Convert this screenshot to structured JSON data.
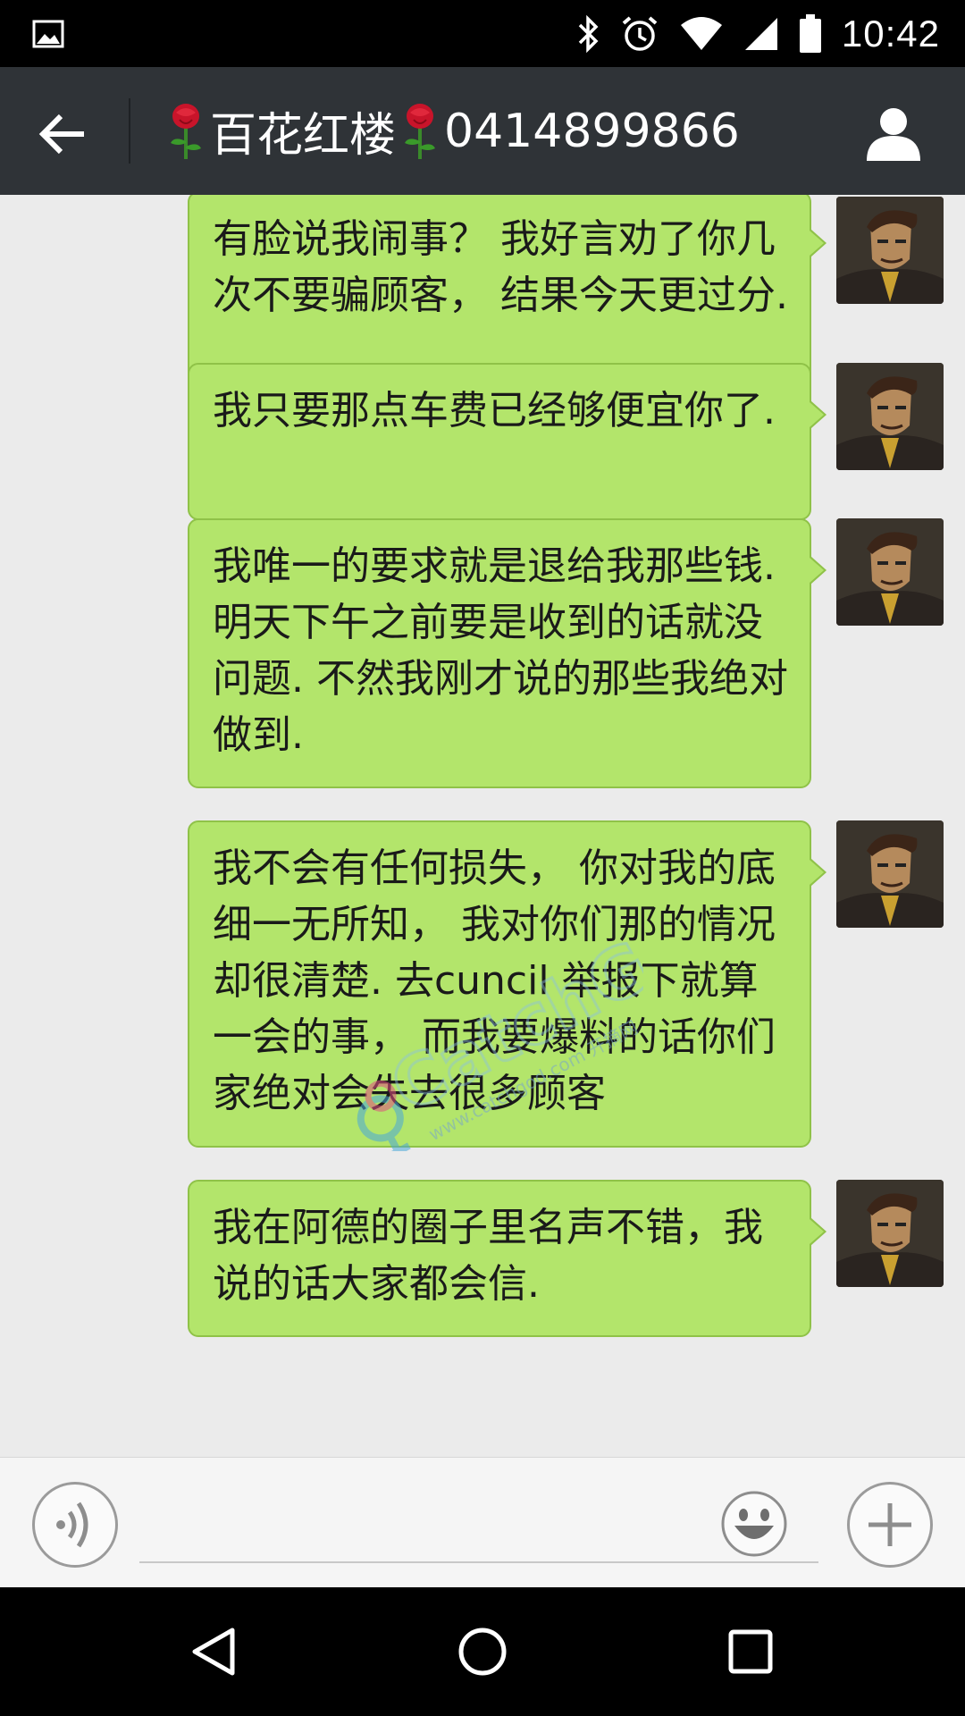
{
  "status_bar": {
    "time": "10:42",
    "icons": [
      "gallery-icon",
      "bluetooth-icon",
      "alarm-icon",
      "wifi-icon",
      "signal-icon",
      "battery-icon"
    ]
  },
  "app_bar": {
    "title": "百花红楼",
    "phone": "0414899866",
    "back_icon": "arrow-left-icon",
    "profile_icon": "person-icon",
    "title_decoration_icon": "rose-icon"
  },
  "messages": [
    {
      "sender": "me",
      "text": "有脸说我闹事？ 我好言劝了你几次不要骗顾客， 结果今天更过分."
    },
    {
      "sender": "me",
      "text": "我只要那点车费已经够便宜你了."
    },
    {
      "sender": "me",
      "text": "我唯一的要求就是退给我那些钱. 明天下午之前要是收到的话就没问题. 不然我刚才说的那些我绝对做到."
    },
    {
      "sender": "me",
      "text": "我不会有任何损失， 你对我的底细一无所知， 我对你们那的情况却很清楚. 去cuncil 举报下就算一会的事， 而我要爆料的话你们家绝对会失去很多顾客"
    },
    {
      "sender": "me",
      "text": "我在阿德的圈子里名声不错，我说的话大家都会信."
    }
  ],
  "watermark": {
    "logo": "CatchGod",
    "url": "www.catchgod.com 开摘网"
  },
  "input_bar": {
    "placeholder": "",
    "voice_icon": "voice-icon",
    "emoji_icon": "emoji-icon",
    "add_icon": "plus-icon"
  },
  "nav_bar": {
    "icons": [
      "back-triangle-icon",
      "home-circle-icon",
      "recents-square-icon"
    ]
  },
  "colors": {
    "bubble": "#b3e56b",
    "app_bar": "#2f3337",
    "chat_bg": "#ebebeb"
  }
}
